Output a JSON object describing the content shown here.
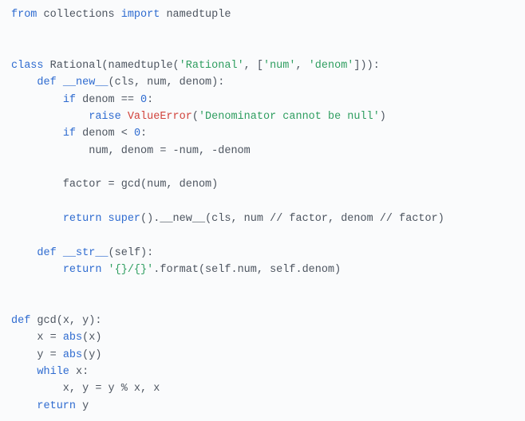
{
  "code": {
    "tokens": [
      [
        [
          "from ",
          "kw"
        ],
        [
          "collections ",
          "p"
        ],
        [
          "import ",
          "kw"
        ],
        [
          "namedtuple",
          "p"
        ]
      ],
      [],
      [],
      [
        [
          "class ",
          "kw"
        ],
        [
          "Rational",
          "p"
        ],
        [
          "(",
          "p"
        ],
        [
          "namedtuple",
          "p"
        ],
        [
          "(",
          "p"
        ],
        [
          "'Rational'",
          "str"
        ],
        [
          ", [",
          "p"
        ],
        [
          "'num'",
          "str"
        ],
        [
          ", ",
          "p"
        ],
        [
          "'denom'",
          "str"
        ],
        [
          "])):",
          "p"
        ]
      ],
      [
        [
          "    ",
          "p"
        ],
        [
          "def ",
          "kw"
        ],
        [
          "__new__",
          "fn"
        ],
        [
          "(",
          "p"
        ],
        [
          "cls, num, denom",
          "p"
        ],
        [
          "):",
          "p"
        ]
      ],
      [
        [
          "        ",
          "p"
        ],
        [
          "if ",
          "kw"
        ],
        [
          "denom == ",
          "p"
        ],
        [
          "0",
          "num"
        ],
        [
          ":",
          "p"
        ]
      ],
      [
        [
          "            ",
          "p"
        ],
        [
          "raise ",
          "kw"
        ],
        [
          "ValueError",
          "err"
        ],
        [
          "(",
          "p"
        ],
        [
          "'Denominator cannot be null'",
          "str"
        ],
        [
          ")",
          "p"
        ]
      ],
      [
        [
          "        ",
          "p"
        ],
        [
          "if ",
          "kw"
        ],
        [
          "denom < ",
          "p"
        ],
        [
          "0",
          "num"
        ],
        [
          ":",
          "p"
        ]
      ],
      [
        [
          "            num, denom = -num, -denom",
          "p"
        ]
      ],
      [],
      [
        [
          "        factor = gcd(num, denom)",
          "p"
        ]
      ],
      [],
      [
        [
          "        ",
          "p"
        ],
        [
          "return ",
          "kw"
        ],
        [
          "super",
          "fn"
        ],
        [
          "().",
          "p"
        ],
        [
          "__new__",
          "p"
        ],
        [
          "(cls, num // factor, denom // factor)",
          "p"
        ]
      ],
      [],
      [
        [
          "    ",
          "p"
        ],
        [
          "def ",
          "kw"
        ],
        [
          "__str__",
          "fn"
        ],
        [
          "(",
          "p"
        ],
        [
          "self",
          "self"
        ],
        [
          "):",
          "p"
        ]
      ],
      [
        [
          "        ",
          "p"
        ],
        [
          "return ",
          "kw"
        ],
        [
          "'{}/{}'",
          "str"
        ],
        [
          ".format(self.num, self.denom)",
          "p"
        ]
      ],
      [],
      [],
      [
        [
          "def ",
          "kw"
        ],
        [
          "gcd",
          "p"
        ],
        [
          "(x, y):",
          "p"
        ]
      ],
      [
        [
          "    x = ",
          "p"
        ],
        [
          "abs",
          "fn"
        ],
        [
          "(x)",
          "p"
        ]
      ],
      [
        [
          "    y = ",
          "p"
        ],
        [
          "abs",
          "fn"
        ],
        [
          "(y)",
          "p"
        ]
      ],
      [
        [
          "    ",
          "p"
        ],
        [
          "while ",
          "kw"
        ],
        [
          "x:",
          "p"
        ]
      ],
      [
        [
          "        x, y = y % x, x",
          "p"
        ]
      ],
      [
        [
          "    ",
          "p"
        ],
        [
          "return ",
          "kw"
        ],
        [
          "y",
          "p"
        ]
      ]
    ]
  },
  "chart_data": {
    "type": "table",
    "title": "Python source code listing",
    "language": "python",
    "plain_text": "from collections import namedtuple\n\n\nclass Rational(namedtuple('Rational', ['num', 'denom'])):\n    def __new__(cls, num, denom):\n        if denom == 0:\n            raise ValueError('Denominator cannot be null')\n        if denom < 0:\n            num, denom = -num, -denom\n\n        factor = gcd(num, denom)\n\n        return super().__new__(cls, num // factor, denom // factor)\n\n    def __str__(self):\n        return '{}/{}'.format(self.num, self.denom)\n\n\ndef gcd(x, y):\n    x = abs(x)\n    y = abs(y)\n    while x:\n        x, y = y % x, x\n    return y"
  }
}
